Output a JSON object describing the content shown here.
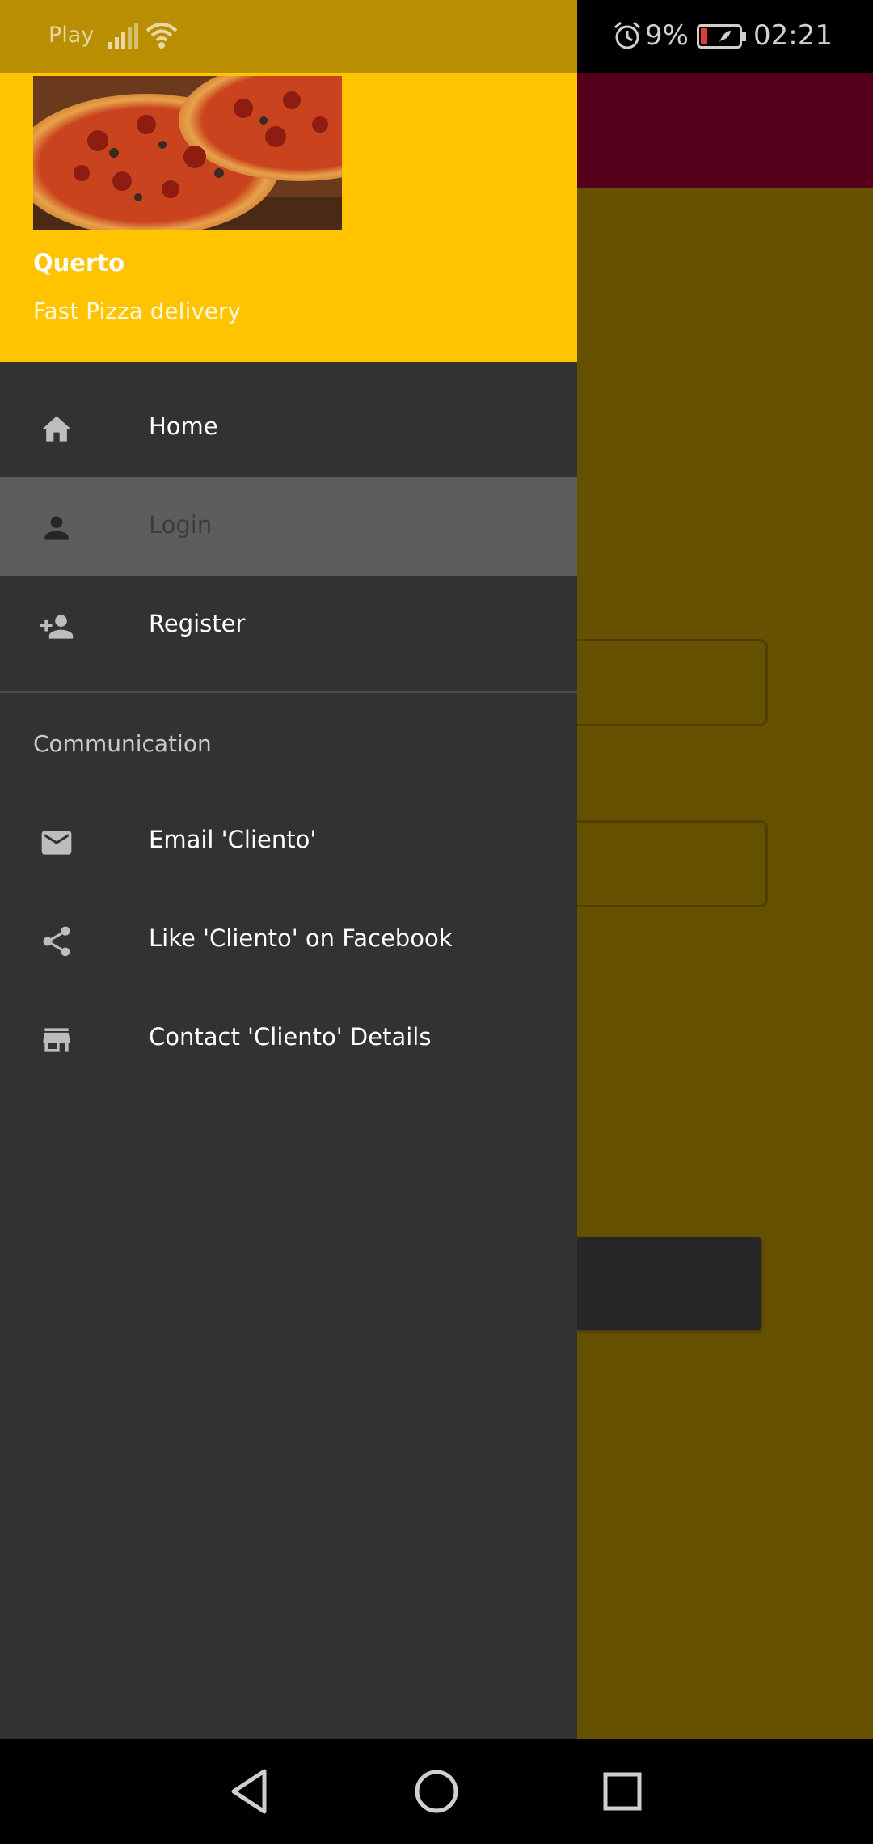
{
  "status_bar": {
    "carrier": "Play",
    "battery_percent": "9%",
    "time": "02:21"
  },
  "drawer": {
    "header": {
      "app_name": "Querto",
      "tagline": "Fast Pizza delivery",
      "image": "pizza-photo"
    },
    "items": [
      {
        "label": "Home",
        "icon": "home-icon",
        "active": false
      },
      {
        "label": "Login",
        "icon": "person-icon",
        "active": true
      },
      {
        "label": "Register",
        "icon": "person-add-icon",
        "active": false
      }
    ],
    "communication": {
      "header": "Communication",
      "items": [
        {
          "label": "Email 'Cliento'",
          "icon": "email-icon"
        },
        {
          "label": "Like 'Cliento' on Facebook",
          "icon": "share-icon"
        },
        {
          "label": "Contact 'Cliento' Details",
          "icon": "store-icon"
        }
      ]
    }
  },
  "colors": {
    "header": "#ffc300",
    "drawer": "#323232",
    "active_item": "#5d5d5d",
    "toolbar": "#55001a",
    "scrim_background": "#655100"
  }
}
